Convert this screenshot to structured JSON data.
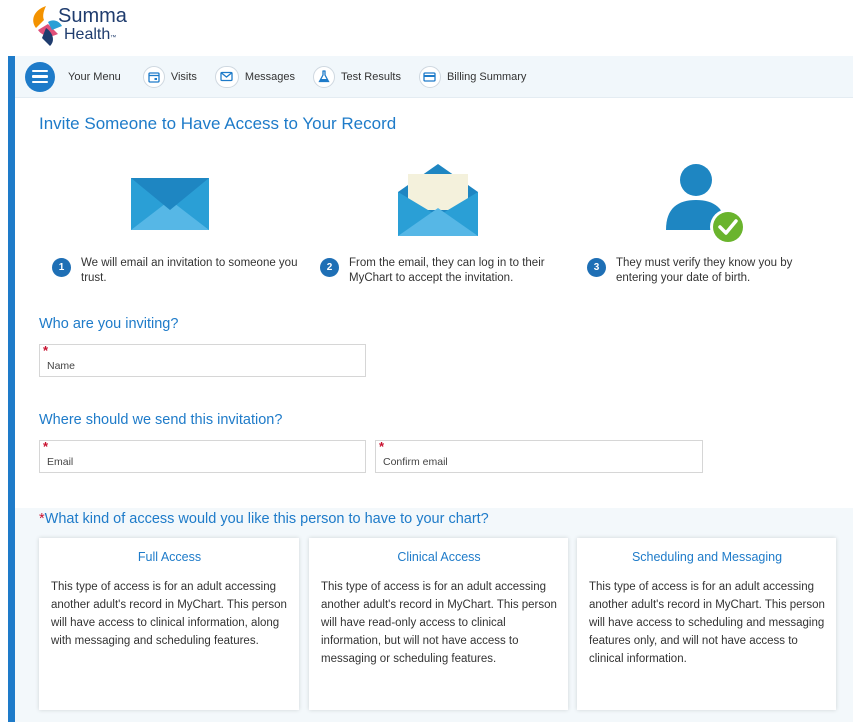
{
  "brand": {
    "line1": "Summa",
    "line2": "Health",
    "tm": "™"
  },
  "menubar": {
    "menu_label": "Your Menu",
    "items": [
      {
        "label": "Visits",
        "icon": "calendar-icon"
      },
      {
        "label": "Messages",
        "icon": "envelope-icon"
      },
      {
        "label": "Test Results",
        "icon": "flask-icon"
      },
      {
        "label": "Billing Summary",
        "icon": "credit-card-icon"
      }
    ]
  },
  "page": {
    "title": "Invite Someone to Have Access to Your Record"
  },
  "steps": [
    {
      "num": "1",
      "text": "We will email an invitation to someone you trust."
    },
    {
      "num": "2",
      "text": "From the email, they can log in to their MyChart to accept the invitation."
    },
    {
      "num": "3",
      "text": "They must verify they know you by entering your date of birth."
    }
  ],
  "who": {
    "title": "Who are you inviting?",
    "name_placeholder": "Name"
  },
  "where": {
    "title": "Where should we send this invitation?",
    "email_placeholder": "Email",
    "confirm_placeholder": "Confirm email"
  },
  "access": {
    "required_mark": "*",
    "title": "What kind of access would you like this person to have to your chart?",
    "options": [
      {
        "title": "Full Access",
        "body": "This type of access is for an adult accessing another adult's record in MyChart. This person will have access to clinical information, along with messaging and scheduling features."
      },
      {
        "title": "Clinical Access",
        "body": "This type of access is for an adult accessing another adult's record in MyChart. This person will have read-only access to clinical information, but will not have access to messaging or scheduling features."
      },
      {
        "title": "Scheduling and Messaging",
        "body": "This type of access is for an adult accessing another adult's record in MyChart. This person will have access to scheduling and messaging features only, and will not have access to clinical information."
      }
    ]
  },
  "colors": {
    "accent": "#1e7bc9",
    "required": "#c8102e",
    "check": "#6ab42d"
  }
}
